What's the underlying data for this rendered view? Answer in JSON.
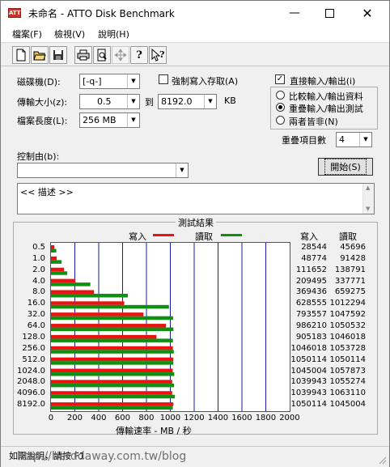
{
  "window": {
    "title": "未命名 - ATTO Disk Benchmark",
    "icon_text": "ATTO"
  },
  "menu": [
    "檔案(F)",
    "檢視(V)",
    "說明(H)"
  ],
  "toolbar": [
    {
      "name": "new-document-icon",
      "glyph": "🗋"
    },
    {
      "name": "open-folder-icon",
      "glyph": "📂"
    },
    {
      "name": "save-icon",
      "glyph": "💾"
    },
    {
      "name": "print-icon",
      "glyph": "🖶"
    },
    {
      "name": "print-preview-icon",
      "glyph": "🔍"
    },
    {
      "name": "move-icon",
      "glyph": "✥"
    },
    {
      "name": "help-icon",
      "glyph": "?"
    },
    {
      "name": "context-help-icon",
      "glyph": "?"
    }
  ],
  "settings": {
    "drive_label": "磁碟機(D):",
    "drive_value": "[-q-]",
    "transfer_label": "傳輸大小(z):",
    "transfer_from": "0.5",
    "to_label": "到",
    "transfer_to": "8192.0",
    "unit": "KB",
    "length_label": "檔案長度(L):",
    "length_value": "256 MB",
    "force_write_label": "強制寫入存取(A)",
    "force_write_checked": false,
    "direct_io_label": "直接輸入/輸出(i)",
    "direct_io_checked": true,
    "radio_options": [
      "比較輸入/輸出資料",
      "重疊輸入/輸出測試",
      "兩者皆非(N)"
    ],
    "radio_selected": 1,
    "queue_label": "重疊項目數",
    "queue_value": "4",
    "control_label": "控制由(b):",
    "control_value": "",
    "start_button": "開始(S)",
    "description": "<< 描述 >>"
  },
  "results": {
    "title": "測試結果",
    "legend_write": "寫入",
    "legend_read": "讀取",
    "col_write": "寫入",
    "col_read": "讀取",
    "write_color": "#ee1111",
    "read_color": "#109010",
    "grid_color": "#1a1aa8",
    "xlabel": "傳輸速率 - MB / 秒"
  },
  "chart_data": {
    "type": "bar",
    "orientation": "horizontal",
    "categories": [
      "0.5",
      "1.0",
      "2.0",
      "4.0",
      "8.0",
      "16.0",
      "32.0",
      "64.0",
      "128.0",
      "256.0",
      "512.0",
      "1024.0",
      "2048.0",
      "4096.0",
      "8192.0"
    ],
    "series": [
      {
        "name": "寫入",
        "values": [
          28544,
          48774,
          111652,
          209495,
          369436,
          628555,
          793557,
          986210,
          905183,
          1046018,
          1050114,
          1045004,
          1039943,
          1039943,
          1050114
        ]
      },
      {
        "name": "讀取",
        "values": [
          45696,
          91428,
          138791,
          337771,
          659275,
          1012294,
          1047592,
          1050532,
          1046018,
          1053728,
          1050114,
          1057873,
          1055274,
          1063110,
          1045004
        ]
      }
    ],
    "xticks": [
      "0",
      "200",
      "400",
      "600",
      "800",
      "1000",
      "1200",
      "1400",
      "1600",
      "1800",
      "2000"
    ],
    "xlim": [
      0,
      2000
    ],
    "xlabel": "傳輸速率 - MB / 秒",
    "grid": true
  },
  "statusbar": {
    "text": "如需說明，請按 F1"
  },
  "watermark": "http://harddaway.com.tw/blog"
}
